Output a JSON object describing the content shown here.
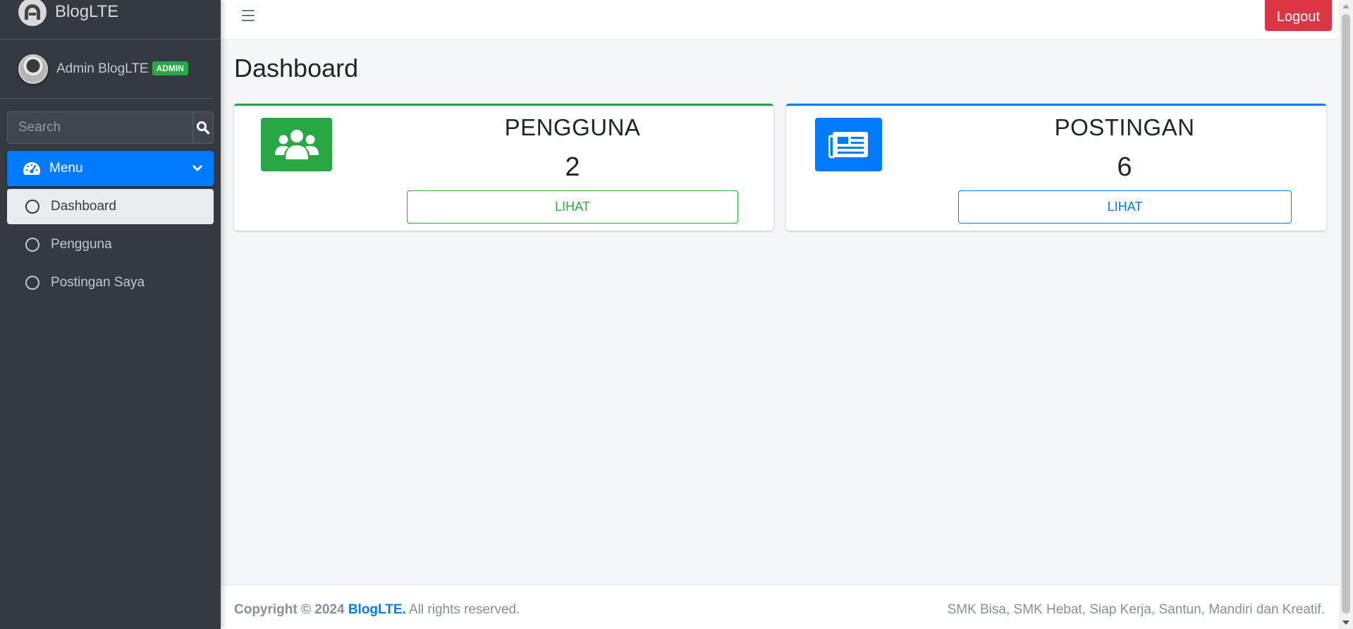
{
  "brand": {
    "name": "BlogLTE"
  },
  "user": {
    "name": "Admin BlogLTE",
    "role_badge": "ADMIN"
  },
  "search": {
    "placeholder": "Search"
  },
  "sidebar": {
    "menu_label": "Menu",
    "items": [
      {
        "label": "Dashboard",
        "active": true
      },
      {
        "label": "Pengguna",
        "active": false
      },
      {
        "label": "Postingan Saya",
        "active": false
      }
    ]
  },
  "topbar": {
    "logout_label": "Logout"
  },
  "page": {
    "title": "Dashboard"
  },
  "cards": [
    {
      "title": "PENGGUNA",
      "count": "2",
      "button": "LIHAT",
      "icon": "users-icon",
      "color": "#28a745"
    },
    {
      "title": "POSTINGAN",
      "count": "6",
      "button": "LIHAT",
      "icon": "newspaper-icon",
      "color": "#007bff"
    }
  ],
  "footer": {
    "copyright_prefix": "Copyright © 2024",
    "brand": "BlogLTE.",
    "rights": "All rights reserved.",
    "tagline": "SMK Bisa, SMK Hebat, Siap Kerja, Santun, Mandiri dan Kreatif."
  },
  "colors": {
    "sidebar_bg": "#343a40",
    "primary": "#007bff",
    "success": "#28a745",
    "danger": "#dc3545"
  }
}
